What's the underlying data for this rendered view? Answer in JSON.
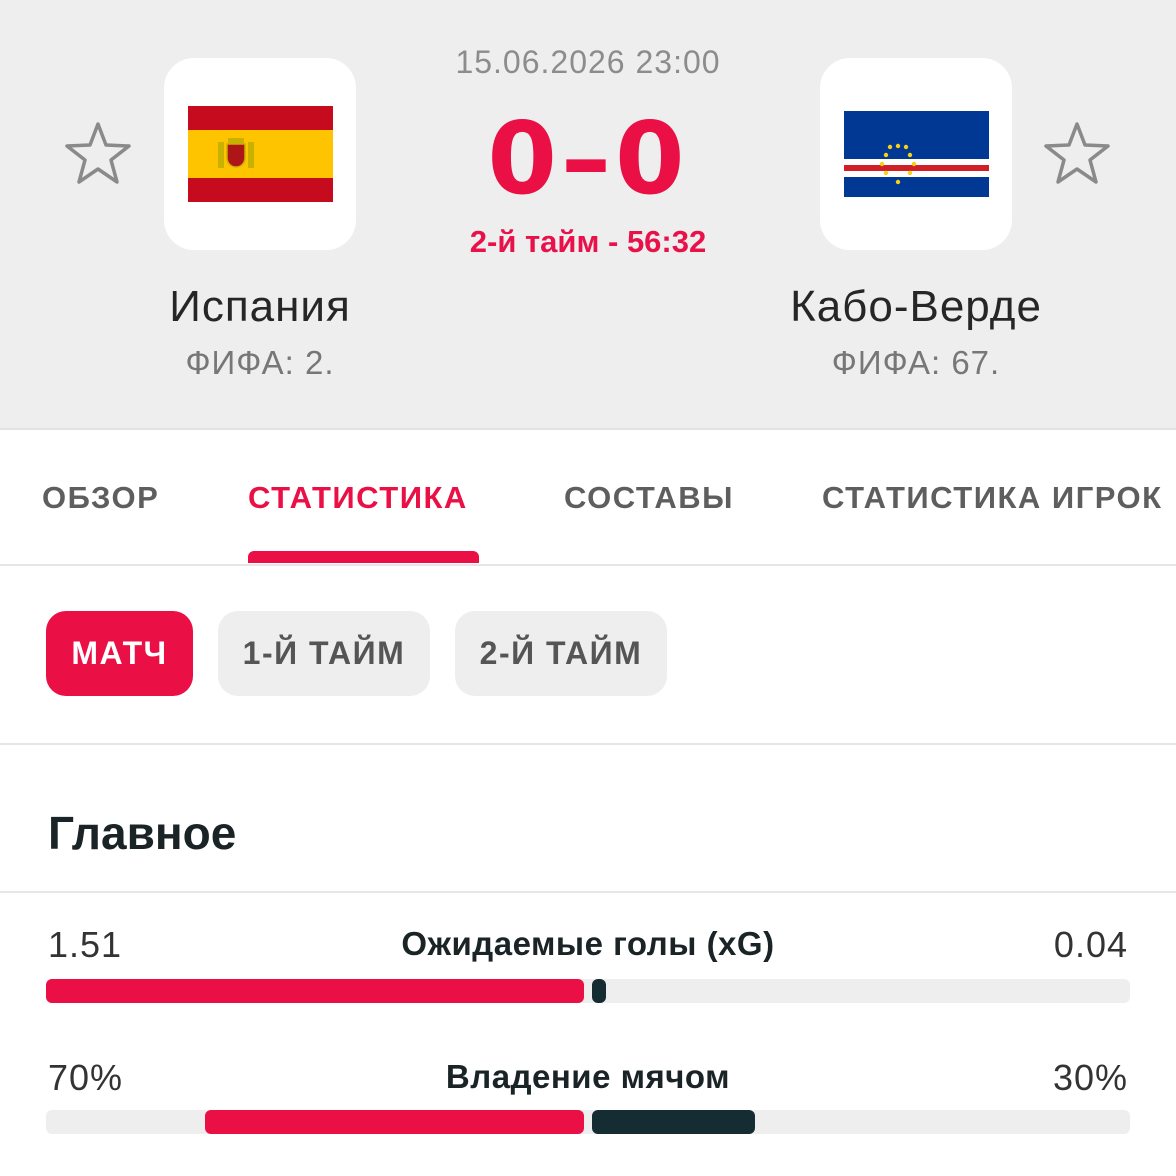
{
  "match": {
    "datetime": "15.06.2026 23:00",
    "score": "0–0",
    "period": "2-й тайм - 56:32"
  },
  "home": {
    "name": "Испания",
    "rank": "ФИФА: 2.",
    "flag_icon": "spain-flag-icon"
  },
  "away": {
    "name": "Кабо-Верде",
    "rank": "ФИФА: 67.",
    "flag_icon": "cape-verde-flag-icon"
  },
  "tabs": [
    {
      "label": "ОБЗОР",
      "active": false
    },
    {
      "label": "СТАТИСТИКА",
      "active": true
    },
    {
      "label": "СОСТАВЫ",
      "active": false
    },
    {
      "label": "СТАТИСТИКА ИГРОК",
      "active": false
    }
  ],
  "period_filters": [
    {
      "label": "МАТЧ",
      "active": true
    },
    {
      "label": "1-Й ТАЙМ",
      "active": false
    },
    {
      "label": "2-Й ТАЙМ",
      "active": false
    }
  ],
  "section": {
    "title": "Главное"
  },
  "stats": [
    {
      "label": "Ожидаемые голы (xG)",
      "home": "1.51",
      "away": "0.04",
      "home_value": 1.51,
      "away_value": 0.04
    },
    {
      "label": "Владение мячом",
      "home": "70%",
      "away": "30%",
      "home_value": 70,
      "away_value": 30
    }
  ],
  "colors": {
    "accent": "#ea0f45",
    "away_bar": "#162c33",
    "header_bg": "#eeeeee"
  }
}
